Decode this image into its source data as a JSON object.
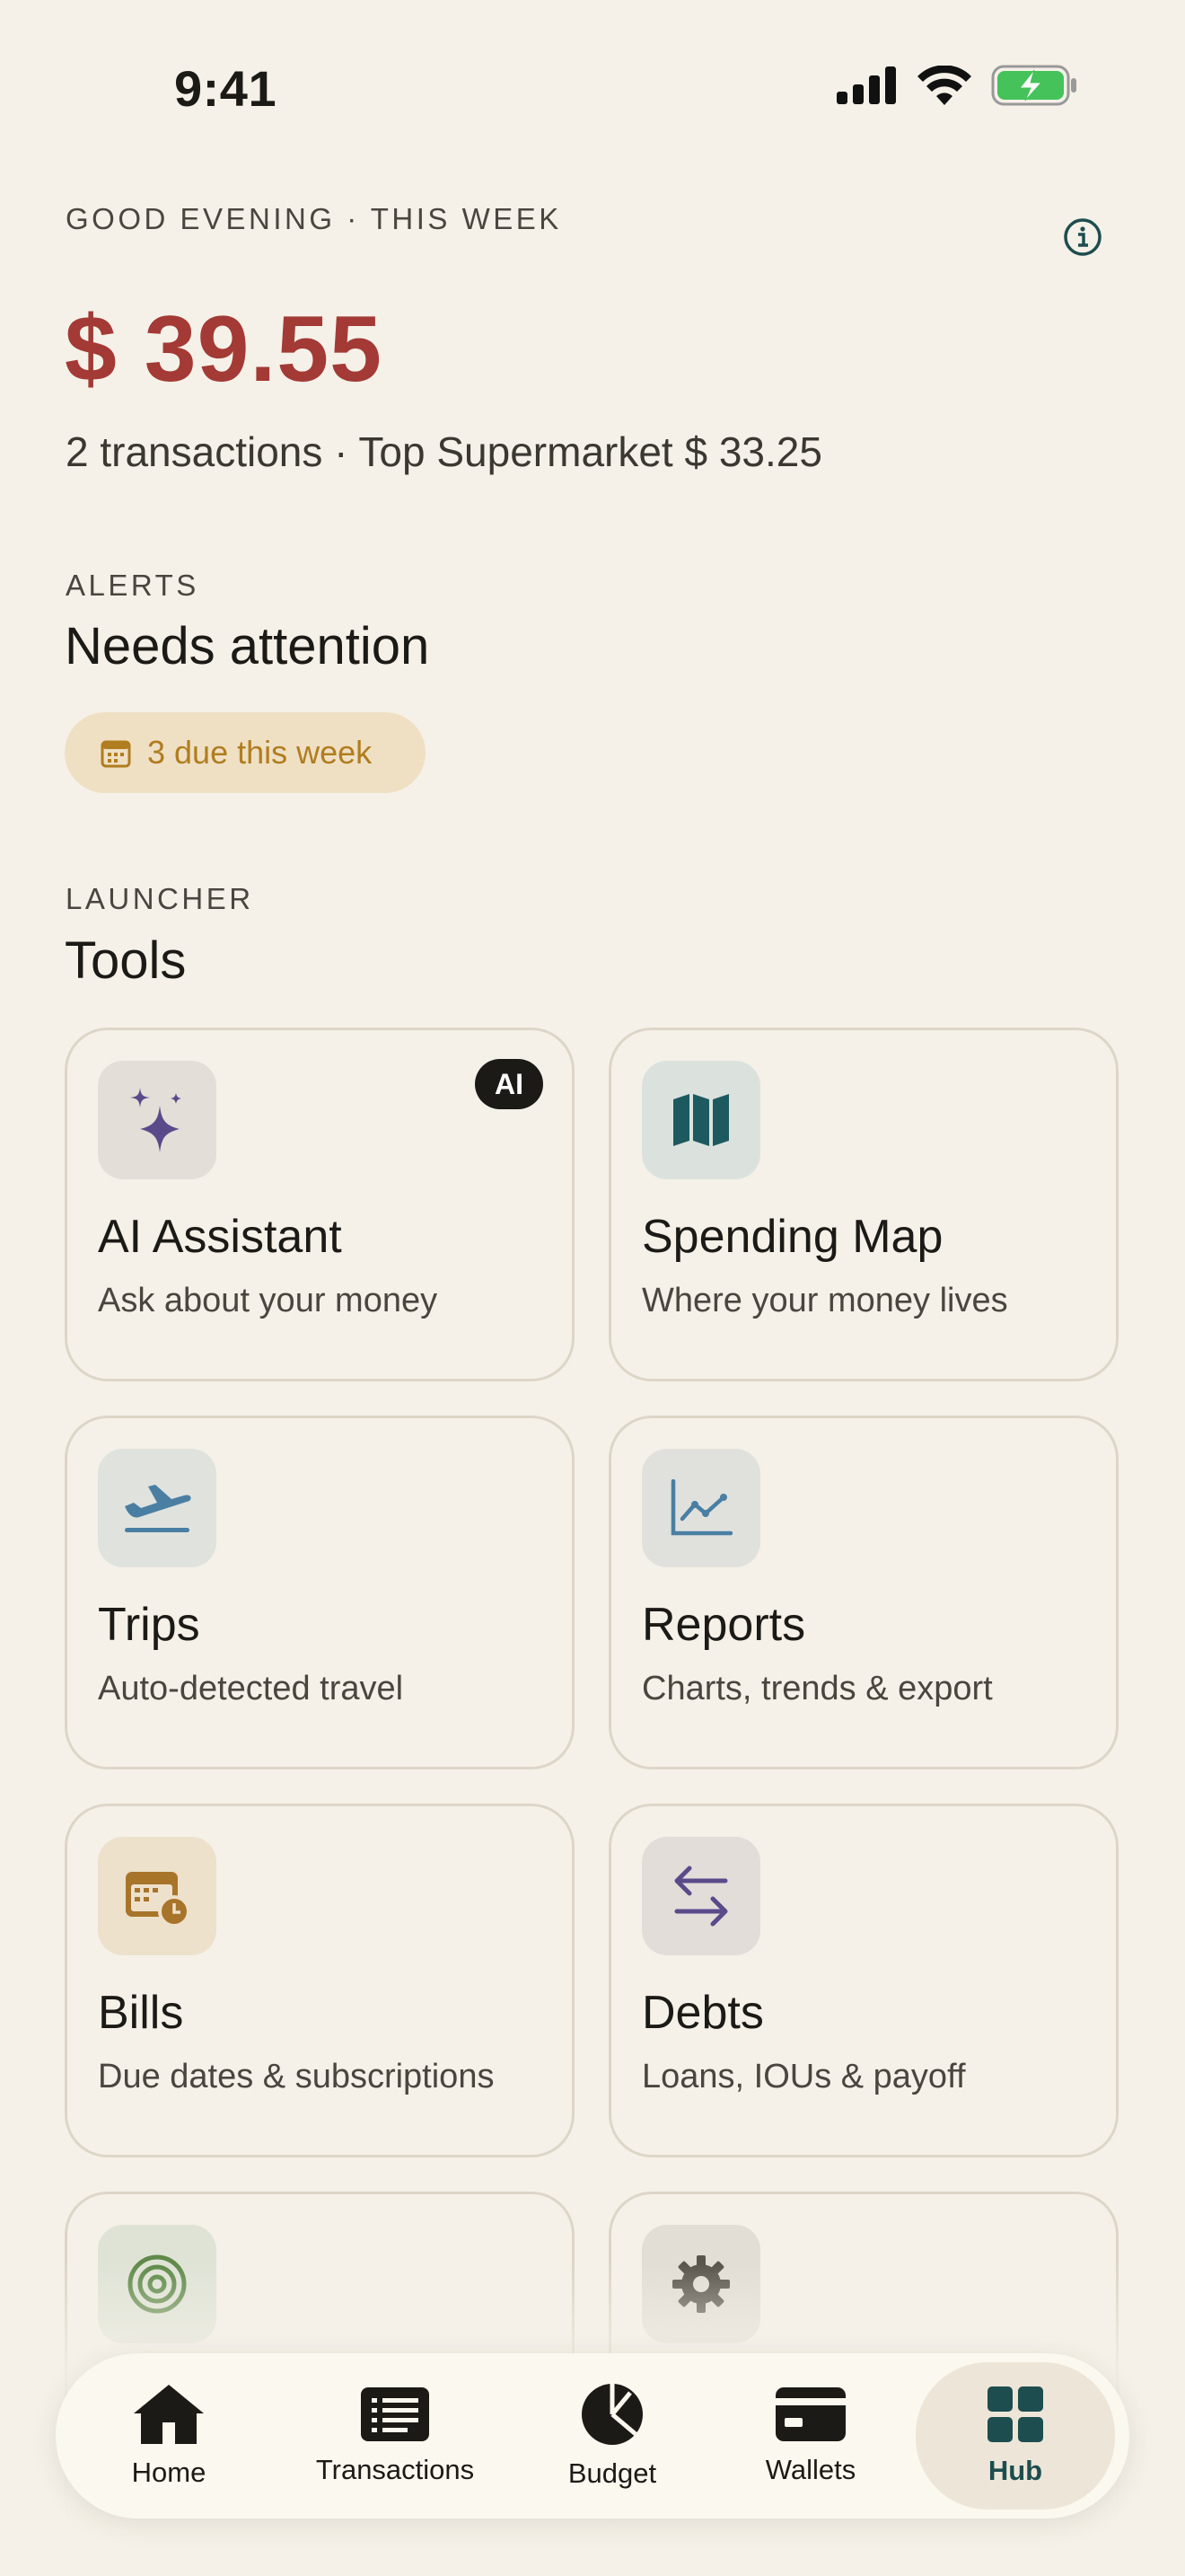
{
  "status": {
    "time": "9:41"
  },
  "header": {
    "greeting": "GOOD EVENING · THIS WEEK",
    "total": "$ 39.55",
    "summary": "2 transactions · Top Supermarket $ 33.25"
  },
  "alerts": {
    "eyebrow": "ALERTS",
    "title": "Needs attention",
    "pill_label": "3 due this week"
  },
  "launcher": {
    "eyebrow": "LAUNCHER",
    "title": "Tools",
    "tools": [
      {
        "title": "AI Assistant",
        "subtitle": "Ask about your money",
        "badge": "AI",
        "icon": "sparkles-icon"
      },
      {
        "title": "Spending Map",
        "subtitle": "Where your money lives",
        "icon": "map-icon"
      },
      {
        "title": "Trips",
        "subtitle": "Auto-detected travel",
        "icon": "airplane-icon"
      },
      {
        "title": "Reports",
        "subtitle": "Charts, trends & export",
        "icon": "line-chart-icon"
      },
      {
        "title": "Bills",
        "subtitle": "Due dates & subscriptions",
        "icon": "calendar-clock-icon"
      },
      {
        "title": "Debts",
        "subtitle": "Loans, IOUs & payoff",
        "icon": "transfer-arrows-icon"
      },
      {
        "title": "",
        "subtitle": "",
        "icon": "target-icon"
      },
      {
        "title": "",
        "subtitle": "",
        "icon": "gear-icon"
      }
    ]
  },
  "nav": {
    "items": [
      {
        "label": "Home",
        "icon": "home-icon"
      },
      {
        "label": "Transactions",
        "icon": "list-icon"
      },
      {
        "label": "Budget",
        "icon": "pie-chart-icon"
      },
      {
        "label": "Wallets",
        "icon": "wallet-icon"
      },
      {
        "label": "Hub",
        "icon": "grid-icon"
      }
    ],
    "active": "Hub"
  },
  "colors": {
    "accent_red": "#a33a35",
    "teal": "#1d4d4f",
    "background": "#f5f1e8",
    "alert_bg": "#efe0c4",
    "alert_text": "#b07d1f"
  }
}
